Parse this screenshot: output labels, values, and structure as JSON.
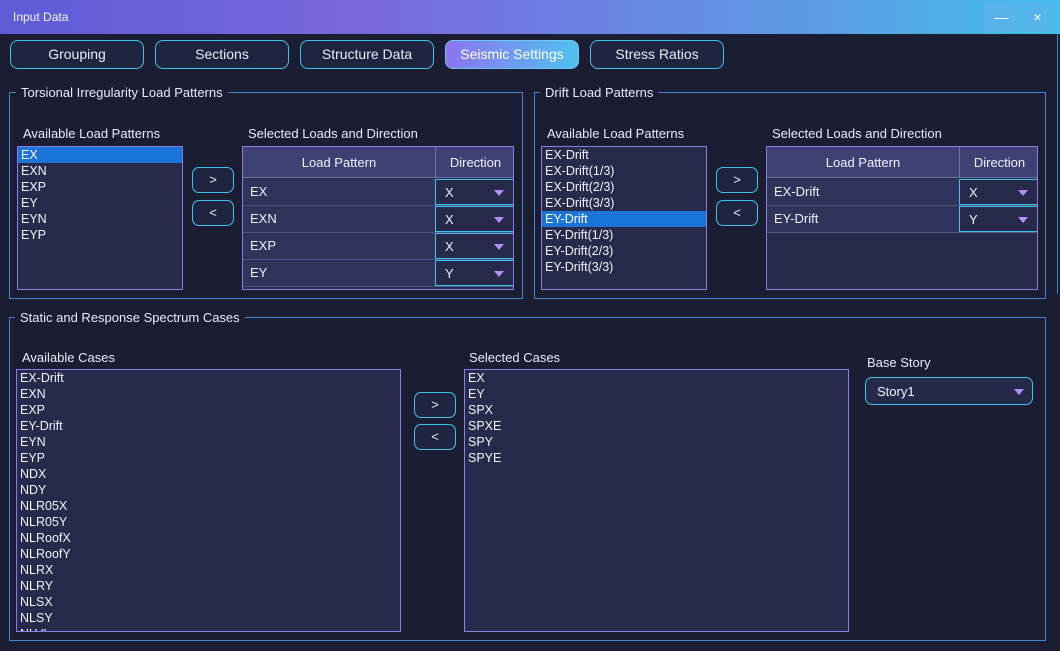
{
  "window": {
    "title": "Input Data",
    "minimize": "—",
    "close": "×"
  },
  "tabs": [
    "Grouping",
    "Sections",
    "Structure Data",
    "Seismic Settings",
    "Stress Ratios"
  ],
  "torsional": {
    "title": "Torsional Irregularity Load Patterns",
    "available_label": "Available Load Patterns",
    "available": [
      "EX",
      "EXN",
      "EXP",
      "EY",
      "EYN",
      "EYP"
    ],
    "selected_label": "Selected Loads and Direction",
    "col_pattern": "Load Pattern",
    "col_direction": "Direction",
    "rows": [
      {
        "pattern": "EX",
        "direction": "X"
      },
      {
        "pattern": "EXN",
        "direction": "X"
      },
      {
        "pattern": "EXP",
        "direction": "X"
      },
      {
        "pattern": "EY",
        "direction": "Y"
      }
    ],
    "add": ">",
    "remove": "<"
  },
  "drift": {
    "title": "Drift Load Patterns",
    "available_label": "Available Load Patterns",
    "available": [
      "EX-Drift",
      "EX-Drift(1/3)",
      "EX-Drift(2/3)",
      "EX-Drift(3/3)",
      "EY-Drift",
      "EY-Drift(1/3)",
      "EY-Drift(2/3)",
      "EY-Drift(3/3)"
    ],
    "selected_label": "Selected Loads and Direction",
    "col_pattern": "Load Pattern",
    "col_direction": "Direction",
    "rows": [
      {
        "pattern": "EX-Drift",
        "direction": "X"
      },
      {
        "pattern": "EY-Drift",
        "direction": "Y"
      }
    ],
    "add": ">",
    "remove": "<"
  },
  "cases": {
    "title": "Static and Response Spectrum Cases",
    "available_label": "Available Cases",
    "available": [
      "EX-Drift",
      "EXN",
      "EXP",
      "EY-Drift",
      "EYN",
      "EYP",
      "NDX",
      "NDY",
      "NLR05X",
      "NLR05Y",
      "NLRoofX",
      "NLRoofY",
      "NLRX",
      "NLRY",
      "NLSX",
      "NLSY",
      "NLVL"
    ],
    "selected_label": "Selected Cases",
    "selected": [
      "EX",
      "EY",
      "SPX",
      "SPXE",
      "SPY",
      "SPYE"
    ],
    "base_story_label": "Base Story",
    "base_story": "Story1",
    "add": ">",
    "remove": "<"
  },
  "colors": {
    "accent": "#3dc3e8",
    "selection": "#1b74d8",
    "frame": "#3f86c8",
    "list_border": "#8a7fe0"
  }
}
